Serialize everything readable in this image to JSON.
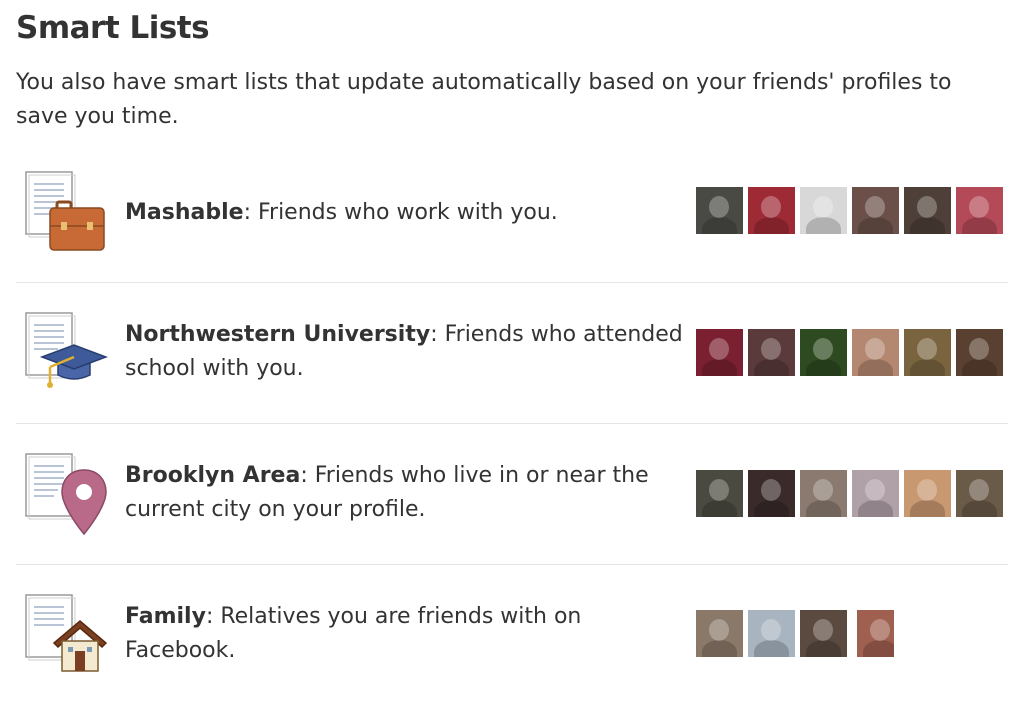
{
  "title": "Smart Lists",
  "intro": "You also have smart lists that update automatically based on your friends' profiles to save you time.",
  "lists": [
    {
      "name": "Mashable",
      "description": ": Friends who work with you.",
      "icon": "briefcase-icon",
      "friend_colors": [
        "#4a4a45",
        "#9e2a35",
        "#d8d8d8",
        "#6a5048",
        "#4e4038",
        "#b44a58"
      ]
    },
    {
      "name": "Northwestern University",
      "description": ": Friends who attended school with you.",
      "icon": "graduation-cap-icon",
      "friend_colors": [
        "#7a2030",
        "#5a3a3a",
        "#2e4a20",
        "#b48870",
        "#7a6440",
        "#5a4030"
      ]
    },
    {
      "name": "Brooklyn Area",
      "description": ": Friends who live in or near the current city on your profile.",
      "icon": "location-pin-icon",
      "friend_colors": [
        "#4a4a40",
        "#3a2a2a",
        "#8a7a70",
        "#b0a0a8",
        "#c89870",
        "#6a5a48"
      ]
    },
    {
      "name": "Family",
      "description": ": Relatives you are friends with on Facebook.",
      "icon": "house-icon",
      "friend_colors": [
        "#8a7868",
        "#a8b4c0",
        "#5a4a40",
        "#a06050"
      ]
    }
  ]
}
